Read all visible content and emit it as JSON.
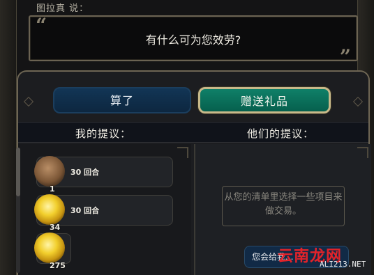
{
  "dialog": {
    "speaker": "图拉真 说：",
    "text": "有什么可为您效劳?",
    "quote_open": "“",
    "quote_close": "”"
  },
  "buttons": {
    "cancel": "算了",
    "gift": "赠送礼品"
  },
  "columns": {
    "mine": "我的提议：",
    "theirs": "他们的提议："
  },
  "my_items": [
    {
      "icon": "horse-icon",
      "qty": "1",
      "turns": "30 回合"
    },
    {
      "icon": "gold-icon",
      "qty": "34",
      "turns": "30 回合"
    },
    {
      "icon": "gold-icon",
      "qty": "275",
      "turns": ""
    }
  ],
  "their_offer": {
    "empty_text": "从您的清单里选择一些项目来做交易。",
    "give_label": "您会给我..."
  },
  "watermark": {
    "main": "云南龙网",
    "sub": "ALI213.NET"
  },
  "colors": {
    "gift_button": "#0f8068",
    "cancel_button": "#123555",
    "frame": "#6e6654",
    "watermark": "#e3232a"
  }
}
